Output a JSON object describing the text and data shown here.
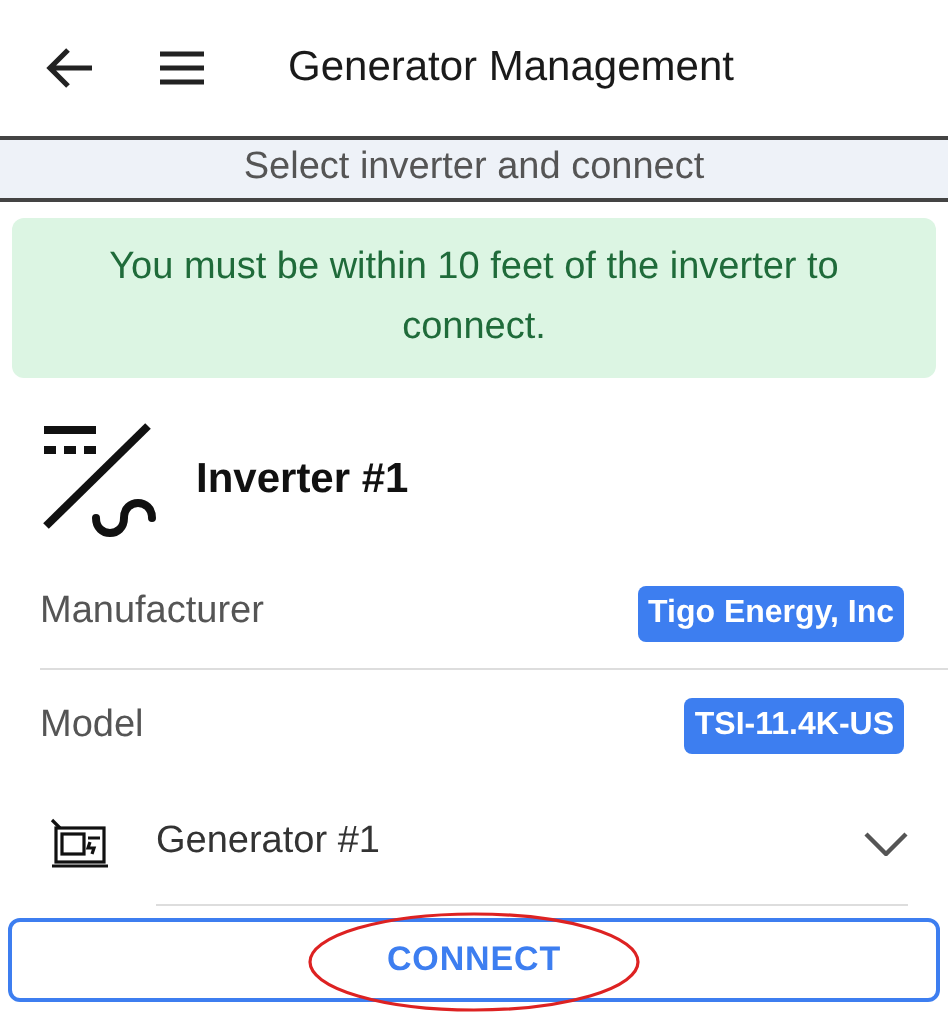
{
  "header": {
    "title": "Generator Management"
  },
  "banner": "Select inverter and connect",
  "alert": "You must be within 10 feet of the inverter to connect.",
  "inverter": {
    "name": "Inverter #1"
  },
  "details": [
    {
      "label": "Manufacturer",
      "value": "Tigo Energy, Inc"
    },
    {
      "label": "Model",
      "value": "TSI-11.4K-US"
    }
  ],
  "generator_select": {
    "value": "Generator #1"
  },
  "connect_button": {
    "label": "CONNECT",
    "circled": true
  }
}
